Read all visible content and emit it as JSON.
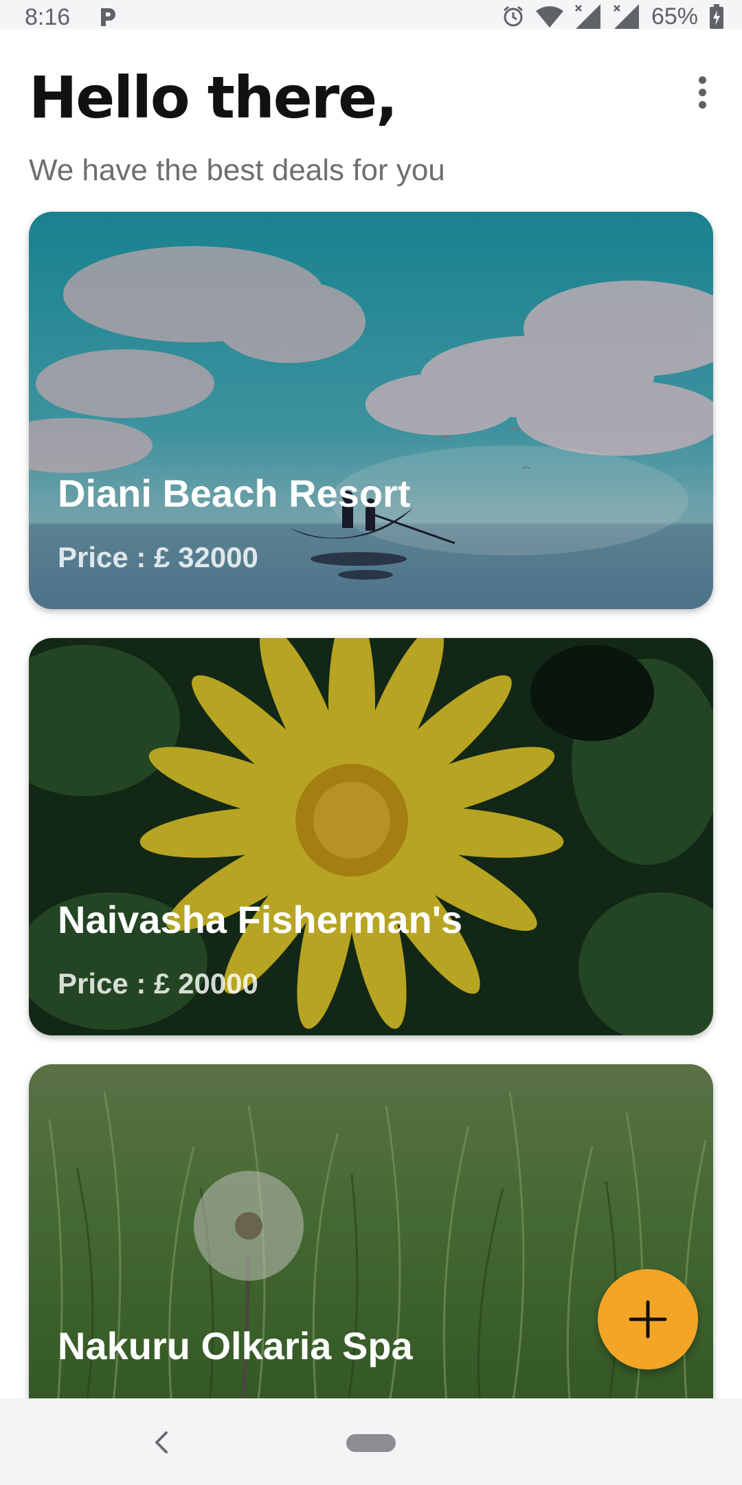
{
  "status_bar": {
    "time": "8:16",
    "battery_percent": "65%",
    "icons": [
      "parking-icon",
      "alarm-icon",
      "wifi-icon",
      "signal-icon",
      "signal-icon",
      "battery-charging-icon"
    ]
  },
  "header": {
    "title": "Hello there,",
    "subtitle": "We have the best deals for you",
    "menu_icon": "more-vertical-icon"
  },
  "deals": [
    {
      "name": "Diani Beach Resort",
      "price": "Price : £ 32000",
      "image": "sea-sky-boat-photo"
    },
    {
      "name": "Naivasha Fisherman's",
      "price": "Price : £ 20000",
      "image": "yellow-flower-photo"
    },
    {
      "name": "Nakuru Olkaria Spa",
      "image": "dandelion-grass-photo"
    }
  ],
  "fab": {
    "icon": "plus-icon",
    "color": "#f5a526"
  },
  "nav_bar": {
    "back_icon": "chevron-left-icon",
    "home_icon": "home-pill-icon"
  }
}
